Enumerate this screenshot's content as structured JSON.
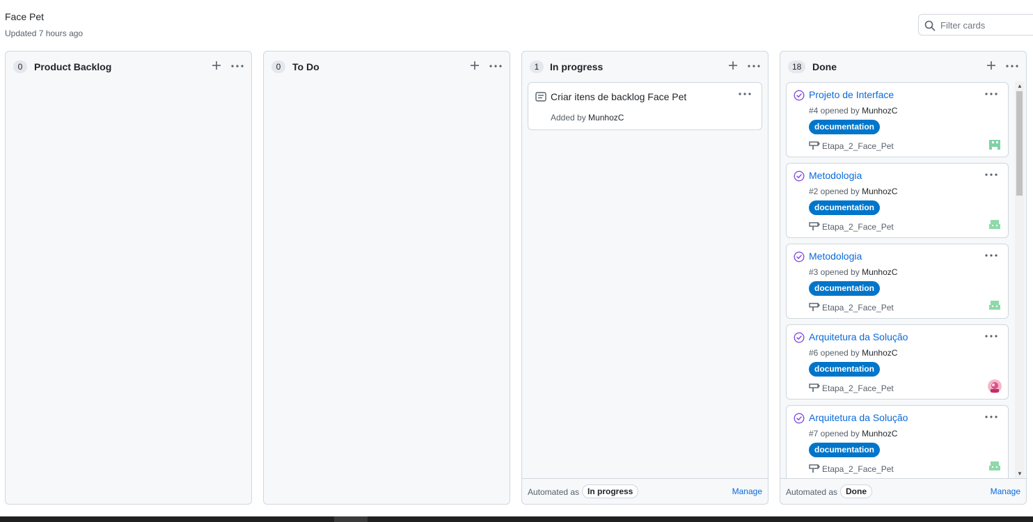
{
  "project": {
    "title": "Face Pet",
    "updated": "Updated 7 hours ago"
  },
  "filter": {
    "placeholder": "Filter cards",
    "icon": "search-icon"
  },
  "colors": {
    "link": "#0969da",
    "label_documentation": "#0075ca",
    "closed_issue": "#8250df"
  },
  "columns": [
    {
      "count": "0",
      "name": "Product Backlog"
    },
    {
      "count": "0",
      "name": "To Do"
    },
    {
      "count": "1",
      "name": "In progress",
      "cards": [
        {
          "type": "note",
          "text": "Criar itens de backlog Face Pet",
          "added_prefix": "Added by ",
          "added_by": "MunhozC"
        }
      ],
      "footer": {
        "automated": "Automated as",
        "state": "In progress",
        "manage": "Manage"
      }
    },
    {
      "count": "18",
      "name": "Done",
      "cards": [
        {
          "title": "Projeto de Interface",
          "meta": "#4 opened by ",
          "author": "MunhozC",
          "label": "documentation",
          "milestone": "Etapa_2_Face_Pet"
        },
        {
          "title": "Metodologia",
          "meta": "#2 opened by ",
          "author": "MunhozC",
          "label": "documentation",
          "milestone": "Etapa_2_Face_Pet"
        },
        {
          "title": "Metodologia",
          "meta": "#3 opened by ",
          "author": "MunhozC",
          "label": "documentation",
          "milestone": "Etapa_2_Face_Pet"
        },
        {
          "title": "Arquitetura da Solução",
          "meta": "#6 opened by ",
          "author": "MunhozC",
          "label": "documentation",
          "milestone": "Etapa_2_Face_Pet"
        },
        {
          "title": "Arquitetura da Solução",
          "meta": "#7 opened by ",
          "author": "MunhozC",
          "label": "documentation",
          "milestone": "Etapa_2_Face_Pet"
        }
      ],
      "footer": {
        "automated": "Automated as",
        "state": "Done",
        "manage": "Manage"
      }
    }
  ]
}
